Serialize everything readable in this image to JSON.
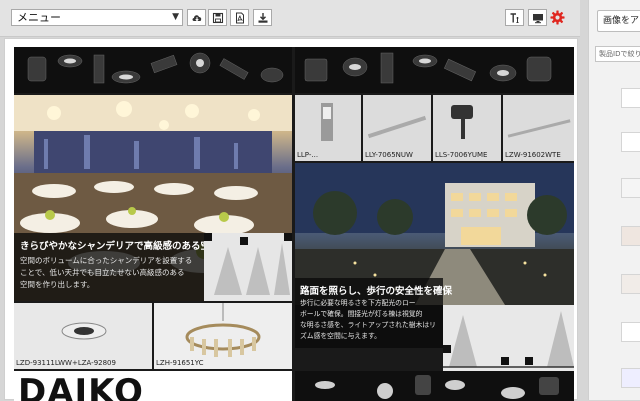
{
  "toolbar": {
    "menu_select_value": "メニュー",
    "icons": [
      "cloud-download-icon",
      "save-icon",
      "pdf-icon",
      "download-icon",
      "text-size-icon",
      "monitor-icon",
      "gear-icon"
    ],
    "accent_color": "#e0261f"
  },
  "catalog": {
    "banquet_caption": {
      "title": "きらびやかなシャンデリアで高級感のある空間に",
      "body": [
        "空間のボリュームに合ったシャンデリアを設置する",
        "ことで、低い天井でも目立たせない高級感のある",
        "空間を作り出します。"
      ]
    },
    "path_caption": {
      "title": "路面を照らし、歩行の安全性を確保",
      "body": [
        "歩行に必要な明るさを下方配光のロー",
        "ボールで確保。間接光が灯る棟は視覚的",
        "な明るさ感を、ライトアップされた樹木はリ",
        "ズム感を空間に与えます。"
      ]
    },
    "products_top": [
      "LLP-...",
      "LLY-7065NUW",
      "LLS-7006YUME",
      "LZW-91602WTE"
    ],
    "products_bottom": [
      "LZD-93111LWW+LZA-92809",
      "LZH-91651YC"
    ],
    "brand_logo": "DAIKO"
  },
  "sidebar": {
    "header": "画像をアップ",
    "search_placeholder": "製品IDで絞り込み"
  }
}
